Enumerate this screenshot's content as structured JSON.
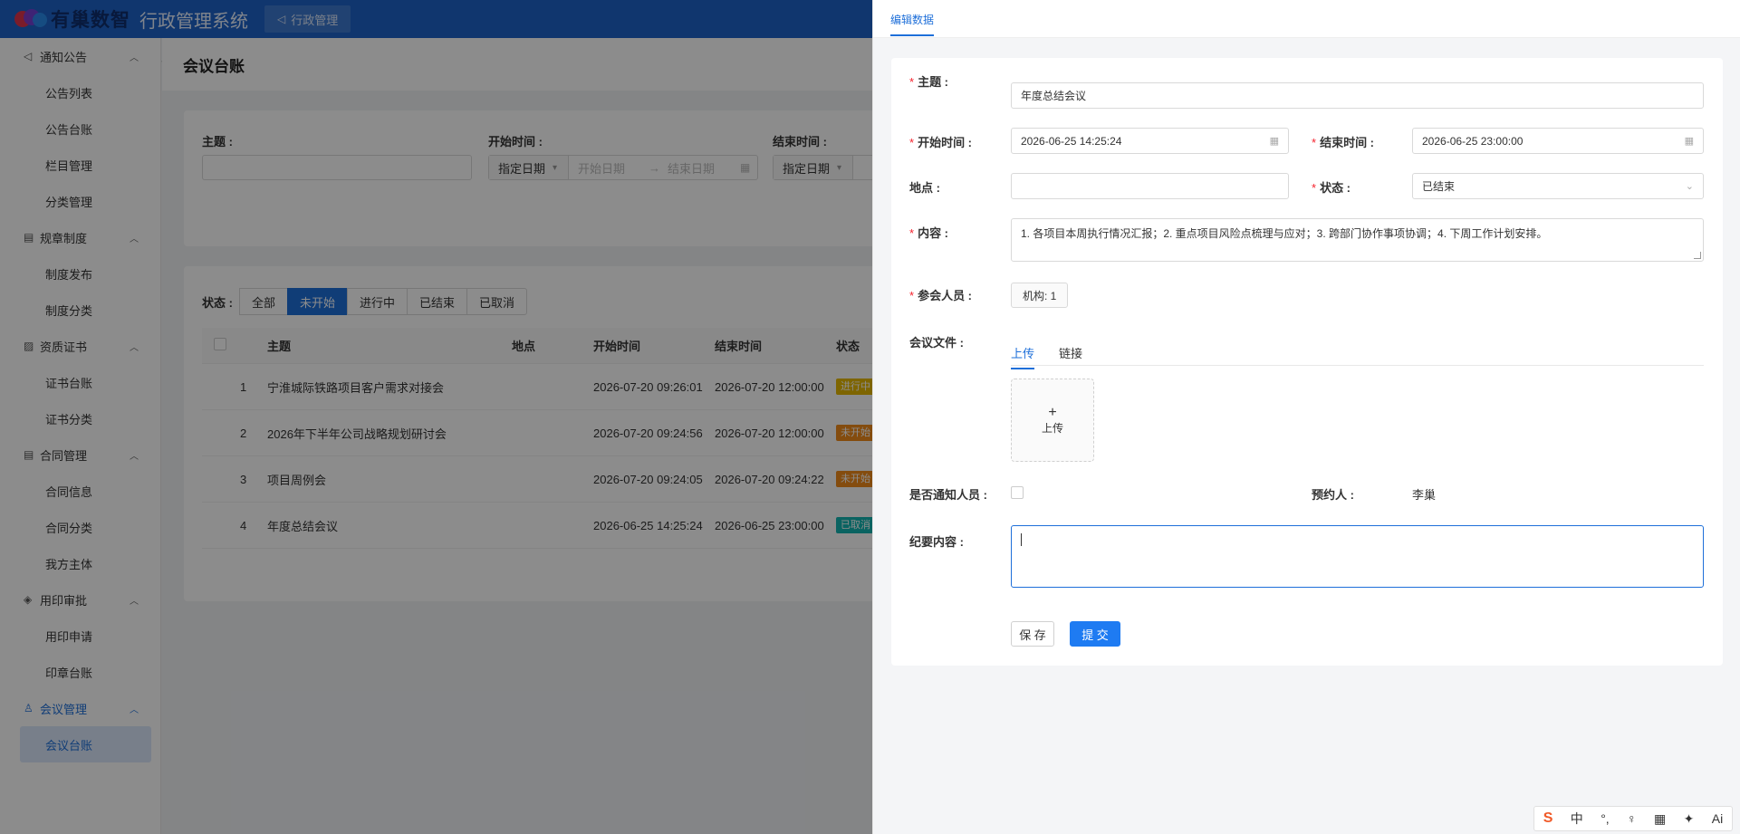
{
  "header": {
    "logo_text": "有巢数智",
    "system_title": "行政管理系统",
    "top_tab": "行政管理"
  },
  "sidebar": {
    "groups": [
      {
        "label": "通知公告",
        "icon": "megaphone-icon",
        "items": [
          "公告列表",
          "公告台账",
          "栏目管理",
          "分类管理"
        ]
      },
      {
        "label": "规章制度",
        "icon": "document-icon",
        "items": [
          "制度发布",
          "制度分类"
        ]
      },
      {
        "label": "资质证书",
        "icon": "certificate-icon",
        "items": [
          "证书台账",
          "证书分类"
        ]
      },
      {
        "label": "合同管理",
        "icon": "contract-icon",
        "items": [
          "合同信息",
          "合同分类",
          "我方主体"
        ]
      },
      {
        "label": "用印审批",
        "icon": "diamond-icon",
        "items": [
          "用印申请",
          "印章台账"
        ]
      },
      {
        "label": "会议管理",
        "icon": "people-icon",
        "items": [
          "会议台账"
        ]
      }
    ]
  },
  "page": {
    "title": "会议台账",
    "filters": {
      "subject_label": "主题 :",
      "start_label": "开始时间 :",
      "end_label": "结束时间 :",
      "mode": "指定日期",
      "start_ph": "开始日期",
      "end_ph": "结束日期"
    },
    "status_label": "状态 :",
    "status_tabs": [
      "全部",
      "未开始",
      "进行中",
      "已结束",
      "已取消"
    ],
    "status_selected": "未开始",
    "table": {
      "columns": [
        "主题",
        "地点",
        "开始时间",
        "结束时间",
        "状态"
      ],
      "rows": [
        {
          "idx": "1",
          "subject": "宁淮城际铁路项目客户需求对接会",
          "location": "",
          "start": "2026-07-20 09:26:01",
          "end": "2026-07-20 12:00:00",
          "status": "进行中",
          "status_color": "#e6b800"
        },
        {
          "idx": "2",
          "subject": "2026年下半年公司战略规划研讨会",
          "location": "",
          "start": "2026-07-20 09:24:56",
          "end": "2026-07-20 12:00:00",
          "status": "未开始",
          "status_color": "#f08a1a"
        },
        {
          "idx": "3",
          "subject": "项目周例会",
          "location": "",
          "start": "2026-07-20 09:24:05",
          "end": "2026-07-20 09:24:22",
          "status": "未开始",
          "status_color": "#f08a1a"
        },
        {
          "idx": "4",
          "subject": "年度总结会议",
          "location": "",
          "start": "2026-06-25 14:25:24",
          "end": "2026-06-25 23:00:00",
          "status": "已取消",
          "status_color": "#13b5b1"
        }
      ]
    }
  },
  "drawer": {
    "tab": "编辑数据",
    "form": {
      "subject_label": "主题 :",
      "subject_value": "年度总结会议",
      "start_label": "开始时间 :",
      "start_value": "2026-06-25 14:25:24",
      "end_label": "结束时间 :",
      "end_value": "2026-06-25 23:00:00",
      "location_label": "地点 :",
      "location_value": "",
      "status_label": "状态 :",
      "status_value": "已结束",
      "content_label": "内容 :",
      "content_value": "1. 各项目本周执行情况汇报；2. 重点项目风险点梳理与应对；3. 跨部门协作事项协调；4. 下周工作计划安排。",
      "attendees_label": "参会人员 :",
      "attendees_chip": "机构: 1",
      "files_label": "会议文件 :",
      "upload_tabs": [
        "上传",
        "链接"
      ],
      "upload_button": "上传",
      "notify_label": "是否通知人员 :",
      "booker_label": "预约人 :",
      "booker_value": "李巢",
      "minutes_label": "纪要内容 :",
      "minutes_value": "",
      "save_label": "保 存",
      "submit_label": "提 交"
    }
  },
  "ime": {
    "lang": "中",
    "ai": "Ai"
  },
  "colors": {
    "primary": "#1e6fd9",
    "header_bg": "#1e63c8",
    "required": "#f5222d"
  }
}
